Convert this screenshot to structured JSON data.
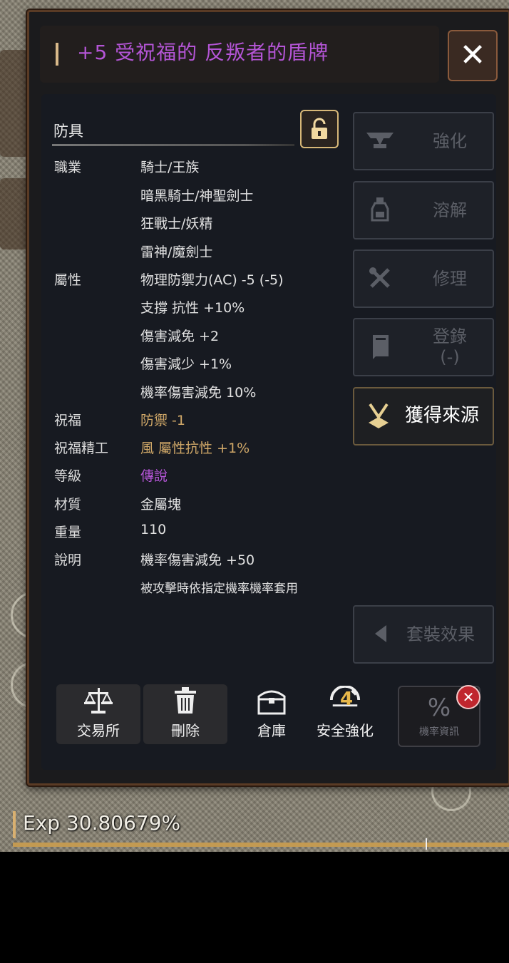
{
  "window": {
    "title": "+5 受祝福的 反叛者的盾牌",
    "close_label": "✕"
  },
  "item": {
    "category": "防具",
    "stats": [
      {
        "label": "職業",
        "values": [
          "騎士/王族",
          "暗黑騎士/神聖劍士",
          "狂戰士/妖精",
          "雷神/魔劍士"
        ]
      },
      {
        "label": "屬性",
        "values": [
          "物理防禦力(AC) -5 (-5)",
          "支撐 抗性 +10%",
          "傷害減免 +2",
          "傷害減少 +1%",
          "機率傷害減免 10%"
        ]
      },
      {
        "label": "祝福",
        "values": [
          "防禦 -1"
        ]
      },
      {
        "label": "祝福精工",
        "values": [
          "風 屬性抗性 +1%"
        ]
      },
      {
        "label": "等級",
        "values": [
          "傳說"
        ]
      },
      {
        "label": "材質",
        "values": [
          "金屬塊"
        ]
      },
      {
        "label": "重量",
        "values": [
          "110"
        ]
      },
      {
        "label": "說明",
        "values": [
          "機率傷害減免 +50",
          "被攻擊時依指定機率機率套用"
        ]
      }
    ]
  },
  "side_buttons": {
    "enhance": "強化",
    "dissolve": "溶解",
    "repair": "修理",
    "register": "登錄",
    "register_sub": "(-)",
    "source": "獲得來源",
    "set_effect": "套裝效果"
  },
  "bottom_buttons": {
    "exchange": "交易所",
    "delete": "刪除",
    "warehouse": "倉庫",
    "safe_enhance": "安全強化",
    "safe_enhance_value": "4",
    "probability_symbol": "%",
    "probability": "機率資訊"
  },
  "hud": {
    "exp": "Exp 30.80679%"
  },
  "colors": {
    "title": "#b455d6",
    "blessing": "#d0a868",
    "legendary": "#b455d6",
    "accent_gold": "#d7b878"
  }
}
